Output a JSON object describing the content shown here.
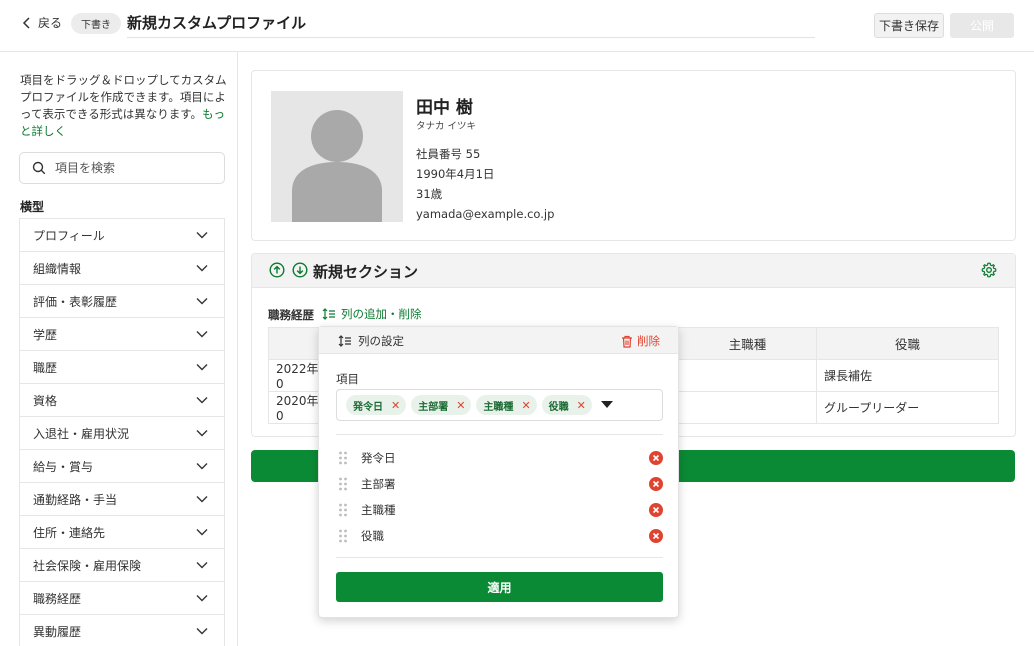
{
  "header": {
    "back_label": "戻る",
    "draft_badge": "下書き",
    "title": "新規カスタムプロファイル",
    "save_draft_label": "下書き保存",
    "publish_label": "公開"
  },
  "sidebar": {
    "help_text": "項目をドラッグ＆ドロップしてカスタムプロファイルを作成できます。項目によって表示できる形式は異なります。",
    "help_link": "もっと詳しく",
    "search_placeholder": "項目を検索",
    "group_title": "横型",
    "categories": [
      "プロフィール",
      "組織情報",
      "評価・表彰履歴",
      "学歴",
      "職歴",
      "資格",
      "入退社・雇用状況",
      "給与・賞与",
      "通勤経路・手当",
      "住所・連絡先",
      "社会保険・雇用保険",
      "職務経歴",
      "異動履歴"
    ]
  },
  "profile": {
    "name": "田中 樹",
    "kana": "タナカ イツキ",
    "employee_no": "社員番号 55",
    "birthday": "1990年4月1日",
    "age": "31歳",
    "email": "yamada@example.co.jp"
  },
  "section": {
    "title": "新規セクション",
    "field_label": "職務経歴",
    "column_action": "列の追加・削除",
    "table": {
      "headers": [
        "",
        "",
        "主職種",
        "役職"
      ],
      "rows": [
        [
          "2022年0",
          "",
          "",
          "課長補佐"
        ],
        [
          "2020年0",
          "",
          "",
          "グループリーダー"
        ]
      ]
    }
  },
  "popover": {
    "title": "列の設定",
    "delete_label": "削除",
    "items_label": "項目",
    "chips": [
      "発令日",
      "主部署",
      "主職種",
      "役職"
    ],
    "columns": [
      "発令日",
      "主部署",
      "主職種",
      "役職"
    ],
    "apply_label": "適用"
  },
  "colors": {
    "accent_green": "#0b8a35",
    "link_green": "#0b7a30",
    "danger_red": "#e0432f"
  },
  "icons": {
    "back": "chevron-left-icon",
    "search": "search-icon",
    "expand": "chevron-down-icon",
    "move_up": "arrow-up-circle-icon",
    "move_down": "arrow-down-circle-icon",
    "settings": "gear-icon",
    "columns": "column-list-icon",
    "trash": "trash-icon",
    "drag": "drag-handle-icon",
    "remove": "remove-circle-icon"
  }
}
